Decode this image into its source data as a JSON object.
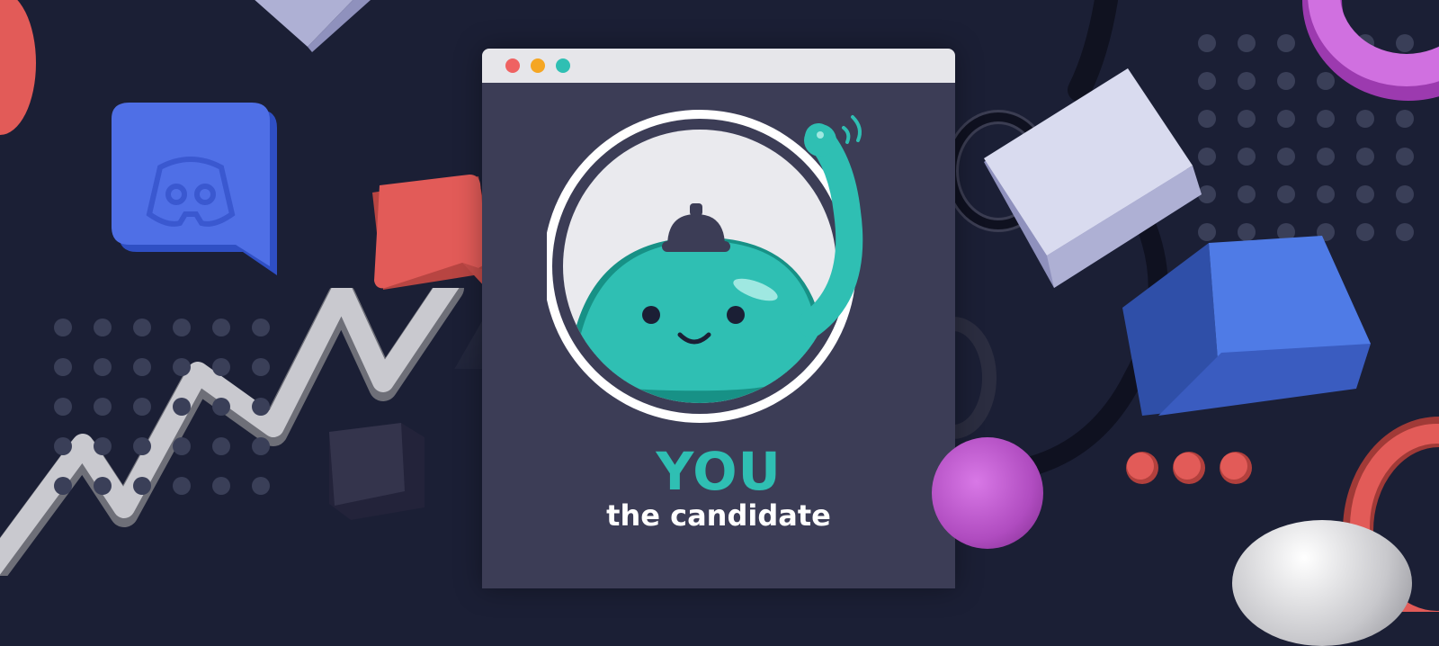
{
  "window": {
    "title": "YOU",
    "subtitle": "the candidate",
    "traffic_lights": [
      "#ef6262",
      "#f5a623",
      "#2fbfb3"
    ],
    "bar_color": "#e6e6ea",
    "body_color": "#3c3d56"
  },
  "colors": {
    "background": "#1b1f35",
    "accent_teal": "#2fbfb3",
    "discord_blue": "#4f6fe6",
    "red": "#e25b58",
    "magenta": "#c766d4",
    "lavender": "#c9cbe3",
    "dot": "#3a3f58"
  },
  "icons": [
    "discord-logo-icon",
    "blob-mascot-icon",
    "chart-zigzag-icon",
    "chat-bubble-icon",
    "cube-icon",
    "torus-icon",
    "sphere-icon"
  ]
}
